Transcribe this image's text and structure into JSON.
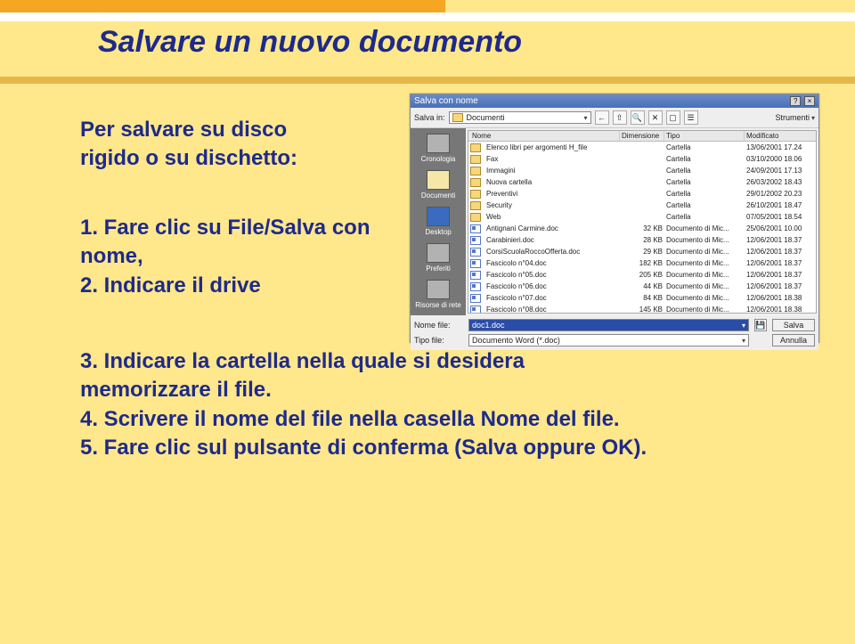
{
  "title": "Salvare un nuovo documento",
  "tb1_l1": "Per salvare su disco",
  "tb1_l2": "rigido o su dischetto:",
  "tb2_l1": "1.  Fare clic su File/Salva con nome,",
  "tb2_l2": "2.  Indicare il drive",
  "tb3_l1": "3.  Indicare la cartella nella quale si desidera",
  "tb3_l2": "     memorizzare il file.",
  "tb3_l3": "4.  Scrivere il nome del file nella casella Nome del file.",
  "tb3_l4": "5.  Fare clic sul pulsante di conferma (Salva oppure OK).",
  "dialog": {
    "title": "Salva con nome",
    "salva_in_label": "Salva in:",
    "salva_in_value": "Documenti",
    "tools_label": "Strumenti",
    "sidebar": [
      "Cronologia",
      "Documenti",
      "Desktop",
      "Preferiti",
      "Risorse di rete"
    ],
    "headers": {
      "name": "Nome",
      "size": "Dimensione",
      "type": "Tipo",
      "mod": "Modificato"
    },
    "rows": [
      {
        "icon": "folder",
        "name": "Elenco libri per argomenti H_file",
        "size": "",
        "type": "Cartella",
        "mod": "13/06/2001 17.24"
      },
      {
        "icon": "folder",
        "name": "Fax",
        "size": "",
        "type": "Cartella",
        "mod": "03/10/2000 18.06"
      },
      {
        "icon": "folder",
        "name": "Immagini",
        "size": "",
        "type": "Cartella",
        "mod": "24/09/2001 17.13"
      },
      {
        "icon": "folder",
        "name": "Nuova cartella",
        "size": "",
        "type": "Cartella",
        "mod": "26/03/2002 18.43"
      },
      {
        "icon": "folder",
        "name": "Preventivi",
        "size": "",
        "type": "Cartella",
        "mod": "29/01/2002 20.23"
      },
      {
        "icon": "folder",
        "name": "Security",
        "size": "",
        "type": "Cartella",
        "mod": "26/10/2001 18.47"
      },
      {
        "icon": "folder",
        "name": "Web",
        "size": "",
        "type": "Cartella",
        "mod": "07/05/2001 18.54"
      },
      {
        "icon": "doc",
        "name": "Antignani Carmine.doc",
        "size": "32 KB",
        "type": "Documento di Mic...",
        "mod": "25/06/2001 10.00"
      },
      {
        "icon": "doc",
        "name": "Carabinieri.doc",
        "size": "28 KB",
        "type": "Documento di Mic...",
        "mod": "12/06/2001 18.37"
      },
      {
        "icon": "doc",
        "name": "CorsiScuolaRoccoOfferta.doc",
        "size": "29 KB",
        "type": "Documento di Mic...",
        "mod": "12/06/2001 18.37"
      },
      {
        "icon": "doc",
        "name": "Fascicolo n°04.doc",
        "size": "182 KB",
        "type": "Documento di Mic...",
        "mod": "12/06/2001 18.37"
      },
      {
        "icon": "doc",
        "name": "Fascicolo n°05.doc",
        "size": "205 KB",
        "type": "Documento di Mic...",
        "mod": "12/06/2001 18.37"
      },
      {
        "icon": "doc",
        "name": "Fascicolo n°06.doc",
        "size": "44 KB",
        "type": "Documento di Mic...",
        "mod": "12/06/2001 18.37"
      },
      {
        "icon": "doc",
        "name": "Fascicolo n°07.doc",
        "size": "84 KB",
        "type": "Documento di Mic...",
        "mod": "12/06/2001 18.38"
      },
      {
        "icon": "doc",
        "name": "Fascicolo n°08.doc",
        "size": "145 KB",
        "type": "Documento di Mic...",
        "mod": "12/06/2001 18.38"
      }
    ],
    "filename_label": "Nome file:",
    "filename_value": "doc1.doc",
    "filetype_label": "Tipo file:",
    "filetype_value": "Documento Word (*.doc)",
    "save_btn": "Salva",
    "cancel_btn": "Annulla"
  }
}
